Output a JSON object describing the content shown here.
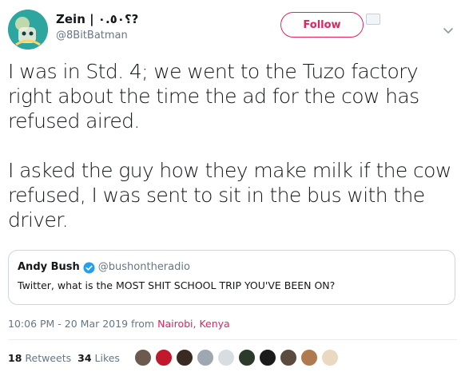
{
  "author": {
    "display_name": "Zein | ؟٠.٥٠?",
    "handle": "@8BitBatman",
    "avatar_icon": "avatar-image"
  },
  "follow_label": "Follow",
  "tweet": {
    "paragraphs": [
      "I was in Std. 4; we went to the Tuzo factory right about the time the ad for the cow has refused aired.",
      "I asked the guy how they make milk if the cow refused, I was sent to sit in the bus with the driver."
    ]
  },
  "quoted": {
    "name": "Andy Bush",
    "handle": "@bushontheradio",
    "text": "Twitter, what is the MOST SHIT SCHOOL TRIP YOU'VE BEEN ON?"
  },
  "meta": {
    "time": "10:06 PM - 20 Mar 2019",
    "from_label": "from",
    "location": "Nairobi, Kenya"
  },
  "stats": {
    "retweets_count": "18",
    "retweets_label": "Retweets",
    "likes_count": "34",
    "likes_label": "Likes"
  },
  "colors": {
    "accent": "#e0245e",
    "muted": "#657786",
    "verified": "#1da1f2"
  },
  "likers": [
    "#6b5a4e",
    "#c0182d",
    "#3a2a24",
    "#9fa7b3",
    "#d8dde2",
    "#2c3a2c",
    "#1b1b1b",
    "#5a4a40",
    "#b07a4f",
    "#e9d9c2"
  ]
}
